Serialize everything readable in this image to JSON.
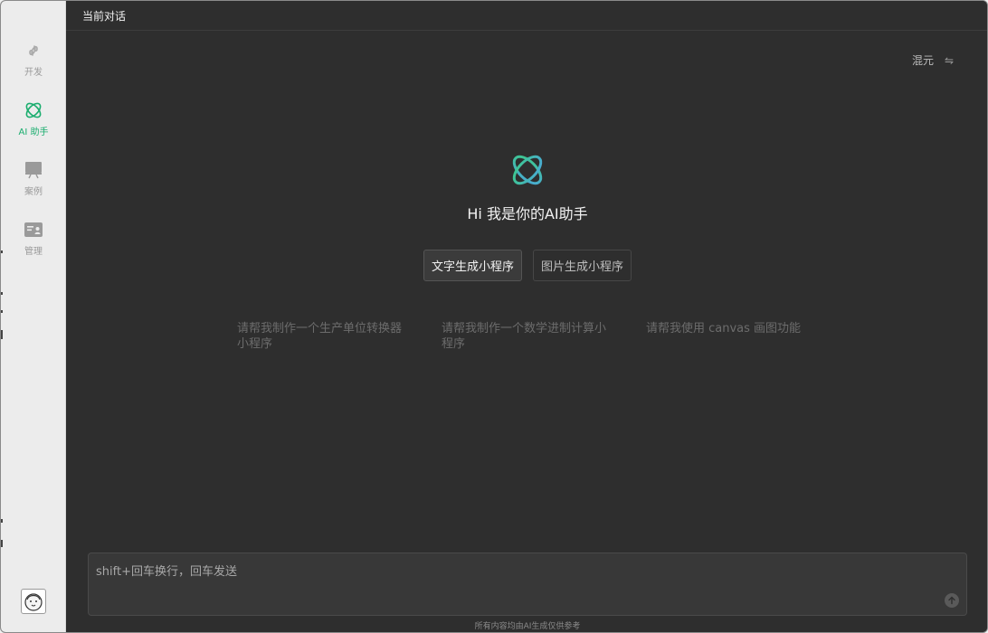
{
  "sidebar": {
    "items": [
      {
        "label": "开发",
        "icon": "link-icon"
      },
      {
        "label": "AI 助手",
        "icon": "atom-icon",
        "active": true
      },
      {
        "label": "案例",
        "icon": "presentation-icon"
      },
      {
        "label": "管理",
        "icon": "id-card-icon"
      }
    ],
    "avatar_icon": "avatar-face-icon"
  },
  "header": {
    "title": "当前对话"
  },
  "model": {
    "name": "混元",
    "switch_icon": "⇋"
  },
  "welcome": {
    "greeting": "Hi 我是你的AI助手",
    "logo_icon": "atom-logo-icon"
  },
  "modes": [
    {
      "label": "文字生成小程序",
      "active": true
    },
    {
      "label": "图片生成小程序",
      "active": false
    }
  ],
  "suggestions": [
    "请帮我制作一个生产单位转换器小程序",
    "请帮我制作一个数学进制计算小程序",
    "请帮我使用 canvas 画图功能"
  ],
  "input": {
    "placeholder": "shift+回车换行，回车发送"
  },
  "footer": {
    "disclaimer": "所有内容均由AI生成仅供参考"
  },
  "colors": {
    "accent": "#1aad6e",
    "logo_gradient_start": "#3cc98a",
    "logo_gradient_end": "#4aa8d8",
    "background": "#2e2e2e"
  }
}
